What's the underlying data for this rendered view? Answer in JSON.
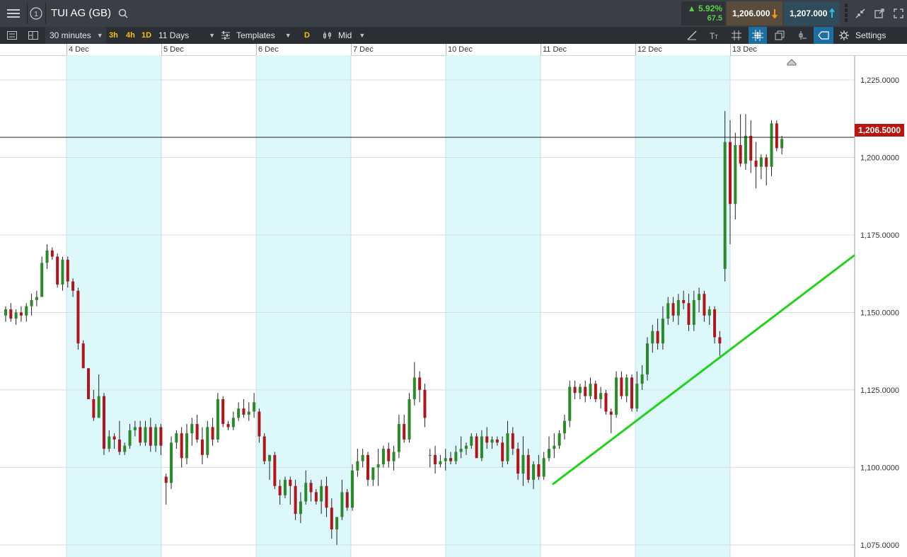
{
  "header": {
    "instrument": "TUI AG (GB)",
    "change_pct": "▲ 5.92%",
    "change_abs": "67.5",
    "sell_price": "1,206.000",
    "buy_price": "1,207.000",
    "colors": {
      "up": "#5ad34b",
      "sell": "#5a4c3b",
      "buy": "#2e4c5a"
    }
  },
  "toolbar": {
    "interval": "30 minutes",
    "quick_3h": "3h",
    "quick_4h": "4h",
    "quick_1d": "1D",
    "range": "11 Days",
    "templates": "Templates",
    "d_badge": "D",
    "price_mode": "Mid",
    "settings": "Settings"
  },
  "dates": [
    "4 Dec",
    "5 Dec",
    "6 Dec",
    "7 Dec",
    "10 Dec",
    "11 Dec",
    "12 Dec",
    "13 Dec"
  ],
  "price_axis": [
    "1,225.0000",
    "1,200.0000",
    "1,175.0000",
    "1,150.0000",
    "1,125.0000",
    "1,100.0000",
    "1,075.0000"
  ],
  "current_price_label": "1,206.5000",
  "icons": [
    "menu-icon",
    "info-icon",
    "search-icon",
    "arrow-down-icon",
    "arrow-up-icon",
    "collapse-icon",
    "popout-icon",
    "expand-icon",
    "list-icon",
    "layout-icon",
    "indicator-icon",
    "bar-type-icon",
    "draw-icon",
    "text-icon",
    "grid-icon",
    "crosshair-icon",
    "copy-icon",
    "pin-icon",
    "label-icon",
    "gear-icon",
    "home-marker-icon"
  ],
  "chart_data": {
    "type": "candlestick",
    "ylim": [
      1072,
      1233
    ],
    "current_price": 1206.5,
    "up_color": "#2a8a2a",
    "down_color": "#b3141b",
    "trendline": {
      "from": [
        61,
        1094.5
      ],
      "to": [
        97,
        1168.5
      ]
    },
    "days": [
      {
        "label": "4 Dec",
        "shaded": true
      },
      {
        "label": "5 Dec",
        "shaded": false
      },
      {
        "label": "6 Dec",
        "shaded": true
      },
      {
        "label": "7 Dec",
        "shaded": false
      },
      {
        "label": "10 Dec",
        "shaded": true
      },
      {
        "label": "11 Dec",
        "shaded": false
      },
      {
        "label": "12 Dec",
        "shaded": true
      },
      {
        "label": "13 Dec",
        "shaded": false
      }
    ],
    "candles": [
      [
        1149,
        1152,
        1147,
        1151
      ],
      [
        1151,
        1153,
        1147,
        1148
      ],
      [
        1148,
        1151,
        1146,
        1150
      ],
      [
        1150,
        1152,
        1147,
        1149
      ],
      [
        1149,
        1153,
        1147,
        1152
      ],
      [
        1152,
        1156,
        1149,
        1154
      ],
      [
        1154,
        1157,
        1152,
        1155
      ],
      [
        1155,
        1168,
        1155,
        1166
      ],
      [
        1166,
        1172,
        1164,
        1170
      ],
      [
        1170,
        1171,
        1167,
        1168
      ],
      [
        1168,
        1169,
        1158,
        1159
      ],
      [
        1159,
        1168,
        1157,
        1167
      ],
      [
        1167,
        1168,
        1158,
        1160
      ],
      [
        1160,
        1161,
        1155,
        1157
      ],
      [
        1157,
        1158,
        1138,
        1140
      ],
      [
        1140,
        1141,
        1132,
        1132
      ],
      [
        1132,
        1132,
        1122,
        1122
      ],
      [
        1122,
        1125,
        1115,
        1116
      ],
      [
        1116,
        1130,
        1116,
        1123
      ],
      [
        1123,
        1124,
        1104,
        1106
      ],
      [
        1106,
        1112,
        1105,
        1110
      ],
      [
        1110,
        1111,
        1106,
        1109
      ],
      [
        1109,
        1115,
        1104,
        1105
      ],
      [
        1105,
        1108,
        1104,
        1107
      ],
      [
        1107,
        1114,
        1106,
        1112
      ],
      [
        1112,
        1115,
        1110,
        1113
      ],
      [
        1113,
        1115,
        1107,
        1108
      ],
      [
        1108,
        1115,
        1107,
        1113
      ],
      [
        1113,
        1116,
        1105,
        1107
      ],
      [
        1107,
        1114,
        1105,
        1113
      ],
      [
        1113,
        1114,
        1104,
        1107
      ],
      [
        1097,
        1098,
        1088,
        1095
      ],
      [
        1095,
        1110,
        1093,
        1108
      ],
      [
        1108,
        1112,
        1106,
        1111
      ],
      [
        1111,
        1113,
        1100,
        1103
      ],
      [
        1103,
        1114,
        1101,
        1111
      ],
      [
        1111,
        1116,
        1107,
        1114
      ],
      [
        1114,
        1117,
        1108,
        1109
      ],
      [
        1109,
        1113,
        1101,
        1104
      ],
      [
        1104,
        1115,
        1103,
        1113
      ],
      [
        1113,
        1116,
        1107,
        1109
      ],
      [
        1109,
        1124,
        1108,
        1122
      ],
      [
        1122,
        1123,
        1113,
        1114
      ],
      [
        1114,
        1115,
        1112,
        1113
      ],
      [
        1113,
        1118,
        1112,
        1116
      ],
      [
        1116,
        1121,
        1115,
        1119
      ],
      [
        1119,
        1122,
        1116,
        1117
      ],
      [
        1117,
        1121,
        1115,
        1118
      ],
      [
        1118,
        1124,
        1116,
        1121
      ],
      [
        1118,
        1119,
        1108,
        1110
      ],
      [
        1110,
        1111,
        1101,
        1102
      ],
      [
        1102,
        1104,
        1096,
        1104
      ],
      [
        1104,
        1105,
        1093,
        1094
      ],
      [
        1094,
        1096,
        1088,
        1091
      ],
      [
        1091,
        1097,
        1090,
        1096
      ],
      [
        1096,
        1097,
        1088,
        1094
      ],
      [
        1094,
        1096,
        1083,
        1085
      ],
      [
        1085,
        1092,
        1082,
        1089
      ],
      [
        1089,
        1099,
        1088,
        1095
      ],
      [
        1095,
        1096,
        1089,
        1092
      ],
      [
        1092,
        1093,
        1088,
        1089
      ],
      [
        1089,
        1096,
        1085,
        1094
      ],
      [
        1094,
        1097,
        1084,
        1087
      ],
      [
        1087,
        1090,
        1077,
        1080
      ],
      [
        1080,
        1084,
        1075,
        1084
      ],
      [
        1084,
        1096,
        1083,
        1092
      ],
      [
        1092,
        1093,
        1086,
        1087
      ],
      [
        1087,
        1101,
        1086,
        1099
      ],
      [
        1099,
        1106,
        1097,
        1102
      ],
      [
        1102,
        1106,
        1100,
        1104
      ],
      [
        1104,
        1105,
        1094,
        1096
      ],
      [
        1096,
        1100,
        1094,
        1100
      ],
      [
        1100,
        1106,
        1094,
        1101
      ],
      [
        1101,
        1107,
        1100,
        1106
      ],
      [
        1106,
        1108,
        1100,
        1102
      ],
      [
        1102,
        1107,
        1099,
        1105
      ],
      [
        1105,
        1117,
        1103,
        1114
      ],
      [
        1114,
        1117,
        1108,
        1109
      ],
      [
        1109,
        1124,
        1108,
        1122
      ],
      [
        1122,
        1134,
        1120,
        1129
      ],
      [
        1129,
        1131,
        1121,
        1125
      ],
      [
        1125,
        1127,
        1113,
        1116
      ],
      [
        1104,
        1106,
        1100,
        1104
      ],
      [
        1104,
        1107,
        1098,
        1101
      ],
      [
        1101,
        1104,
        1100,
        1102
      ],
      [
        1102,
        1106,
        1099,
        1103
      ],
      [
        1103,
        1105,
        1101,
        1102
      ],
      [
        1102,
        1107,
        1101,
        1105
      ],
      [
        1105,
        1110,
        1103,
        1106
      ],
      [
        1106,
        1108,
        1104,
        1107
      ],
      [
        1107,
        1111,
        1106,
        1110
      ],
      [
        1110,
        1111,
        1103,
        1103
      ],
      [
        1103,
        1112,
        1102,
        1110
      ],
      [
        1110,
        1113,
        1106,
        1108
      ],
      [
        1108,
        1110,
        1106,
        1109
      ],
      [
        1109,
        1110,
        1107,
        1108
      ],
      [
        1108,
        1110,
        1100,
        1102
      ],
      [
        1102,
        1115,
        1101,
        1111
      ],
      [
        1111,
        1113,
        1104,
        1106
      ],
      [
        1106,
        1108,
        1096,
        1098
      ],
      [
        1098,
        1110,
        1094,
        1104
      ],
      [
        1104,
        1106,
        1095,
        1096
      ],
      [
        1096,
        1102,
        1093,
        1101
      ],
      [
        1101,
        1104,
        1096,
        1097
      ],
      [
        1097,
        1105,
        1096,
        1103
      ],
      [
        1103,
        1110,
        1102,
        1106
      ],
      [
        1106,
        1111,
        1103,
        1107
      ],
      [
        1107,
        1112,
        1106,
        1111
      ],
      [
        1111,
        1117,
        1109,
        1115
      ],
      [
        1115,
        1128,
        1113,
        1126
      ],
      [
        1126,
        1128,
        1122,
        1124
      ],
      [
        1124,
        1127,
        1122,
        1126
      ],
      [
        1126,
        1128,
        1121,
        1123
      ],
      [
        1123,
        1129,
        1122,
        1127
      ],
      [
        1127,
        1128,
        1121,
        1122
      ],
      [
        1122,
        1126,
        1119,
        1124
      ],
      [
        1124,
        1125,
        1117,
        1118
      ],
      [
        1118,
        1119,
        1111,
        1117
      ],
      [
        1117,
        1131,
        1116,
        1129
      ],
      [
        1129,
        1131,
        1122,
        1123
      ],
      [
        1123,
        1130,
        1121,
        1129
      ],
      [
        1129,
        1130,
        1118,
        1119
      ],
      [
        1119,
        1131,
        1118,
        1127
      ],
      [
        1127,
        1133,
        1125,
        1130
      ],
      [
        1130,
        1142,
        1128,
        1140
      ],
      [
        1140,
        1146,
        1137,
        1144
      ],
      [
        1144,
        1148,
        1138,
        1140
      ],
      [
        1140,
        1152,
        1138,
        1148
      ],
      [
        1148,
        1155,
        1146,
        1153
      ],
      [
        1153,
        1155,
        1147,
        1149
      ],
      [
        1149,
        1156,
        1146,
        1154
      ],
      [
        1154,
        1157,
        1151,
        1153
      ],
      [
        1153,
        1156,
        1144,
        1146
      ],
      [
        1146,
        1157,
        1144,
        1154
      ],
      [
        1154,
        1158,
        1150,
        1156
      ],
      [
        1156,
        1157,
        1147,
        1149
      ],
      [
        1149,
        1152,
        1146,
        1151
      ],
      [
        1151,
        1152,
        1140,
        1142
      ],
      [
        1142,
        1144,
        1136,
        1140
      ],
      [
        1164,
        1215,
        1160,
        1205
      ],
      [
        1205,
        1212,
        1172,
        1185
      ],
      [
        1185,
        1208,
        1180,
        1204
      ],
      [
        1204,
        1214,
        1197,
        1198
      ],
      [
        1198,
        1214,
        1196,
        1207
      ],
      [
        1207,
        1212,
        1195,
        1199
      ],
      [
        1199,
        1205,
        1190,
        1197
      ],
      [
        1197,
        1201,
        1193,
        1200
      ],
      [
        1200,
        1201,
        1191,
        1197
      ],
      [
        1197,
        1212,
        1194,
        1211
      ],
      [
        1211,
        1212,
        1202,
        1203
      ],
      [
        1203,
        1207,
        1201,
        1206
      ]
    ]
  }
}
